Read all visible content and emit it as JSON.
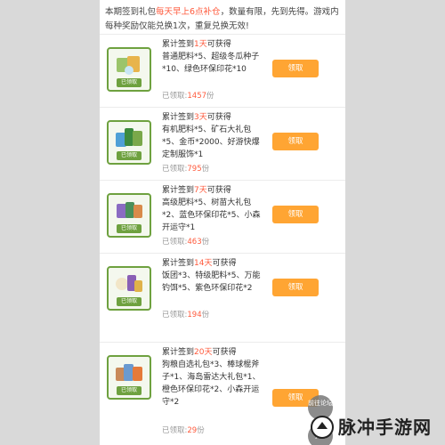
{
  "notice": {
    "text1": "本期签到礼包",
    "highlight": "每天早上6点补仓",
    "text2": "，数量有限，先到先得。游戏内每种奖励仅能兑换1次，重复兑换无效!"
  },
  "common": {
    "title_prefix": "累计签到",
    "title_suffix": "可获得",
    "claimed_prefix": "已领取:",
    "claimed_suffix": "份",
    "claim_label": "领取"
  },
  "items": [
    {
      "days": "1天",
      "desc": "普通肥料*5、超级冬瓜种子*10、绿色环保印花*10",
      "claimed": "1457",
      "tag": "已领取"
    },
    {
      "days": "3天",
      "desc": "有机肥料*5、矿石大礼包*5、金币*2000、好游快爆定制服饰*1",
      "claimed": "795",
      "tag": "已领取"
    },
    {
      "days": "7天",
      "desc": "高级肥料*5、树苗大礼包*2、蓝色环保印花*5、小森开运守*1",
      "claimed": "463",
      "tag": "已领取"
    },
    {
      "days": "14天",
      "desc": "饭团*3、特级肥料*5、万能钓饵*5、紫色环保印花*2",
      "claimed": "194",
      "tag": "已领取"
    },
    {
      "days": "20天",
      "desc": "狗粮自选礼包*3、棒球棍斧子*1、海岛雷达大礼包*1、橙色环保印花*2、小森开运守*2",
      "claimed": "29",
      "tag": "已领取"
    }
  ],
  "fab": {
    "forum": "前往论坛",
    "top_icon": "up-arrow-icon"
  },
  "watermark": {
    "text": "脉冲手游网",
    "logo_icon": "circle-logo-icon"
  },
  "colors": {
    "accent": "#ff5a3c",
    "button": "#ffa533",
    "thumb_border": "#6ea13f"
  }
}
